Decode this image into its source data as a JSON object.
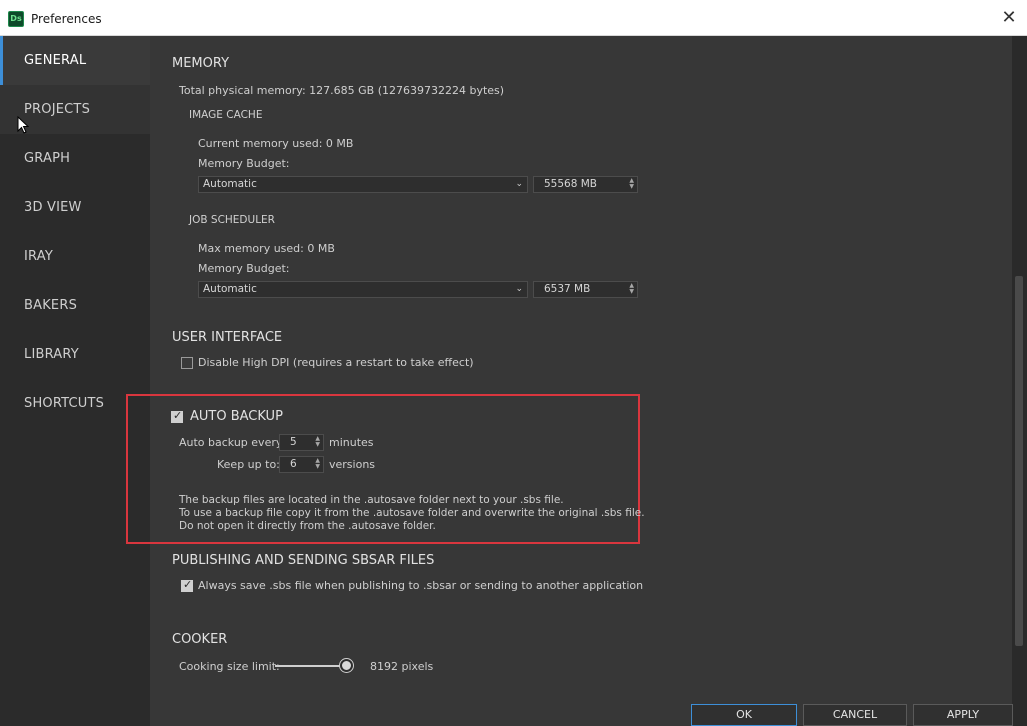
{
  "window": {
    "title": "Preferences",
    "app_icon_label": "Ds"
  },
  "sidebar": {
    "items": [
      {
        "label": "GENERAL"
      },
      {
        "label": "PROJECTS"
      },
      {
        "label": "GRAPH"
      },
      {
        "label": "3D VIEW"
      },
      {
        "label": "IRAY"
      },
      {
        "label": "BAKERS"
      },
      {
        "label": "LIBRARY"
      },
      {
        "label": "SHORTCUTS"
      }
    ],
    "active": "GENERAL"
  },
  "memory": {
    "heading": "MEMORY",
    "total": "Total physical memory:  127.685 GB (127639732224 bytes)",
    "image_cache": {
      "heading": "IMAGE CACHE",
      "used": "Current memory used:  0 MB",
      "budget_label": "Memory Budget:",
      "budget_mode": "Automatic",
      "budget_value": "55568 MB"
    },
    "job_scheduler": {
      "heading": "JOB SCHEDULER",
      "used": "Max memory used:  0 MB",
      "budget_label": "Memory Budget:",
      "budget_mode": "Automatic",
      "budget_value": "6537 MB"
    }
  },
  "user_interface": {
    "heading": "USER INTERFACE",
    "high_dpi_label": "Disable High DPI (requires a restart to take effect)",
    "high_dpi_checked": false
  },
  "auto_backup": {
    "heading": "AUTO BACKUP",
    "enabled": true,
    "every_label": "Auto backup every:",
    "every_value": "5",
    "every_unit": "minutes",
    "keep_label": "Keep up to:",
    "keep_value": "6",
    "keep_unit": "versions",
    "info_line1": "The backup files are located in the .autosave folder next to your .sbs file.",
    "info_line2": "To use a backup file copy it from the .autosave folder and overwrite the original .sbs file.",
    "info_line3": "Do not open it directly from the .autosave folder."
  },
  "publishing": {
    "heading": "PUBLISHING AND SENDING SBSAR FILES",
    "always_save_label": "Always save .sbs file when publishing to .sbsar or sending to another application",
    "always_save_checked": true
  },
  "cooker": {
    "heading": "COOKER",
    "size_label": "Cooking size limit:",
    "size_value": "8192 pixels"
  },
  "footer": {
    "ok": "OK",
    "cancel": "CANCEL",
    "apply": "APPLY"
  },
  "colors": {
    "accent": "#3d8fd8",
    "highlight": "#d9363e",
    "panel": "#373737",
    "sidebar": "#2b2b2b"
  }
}
